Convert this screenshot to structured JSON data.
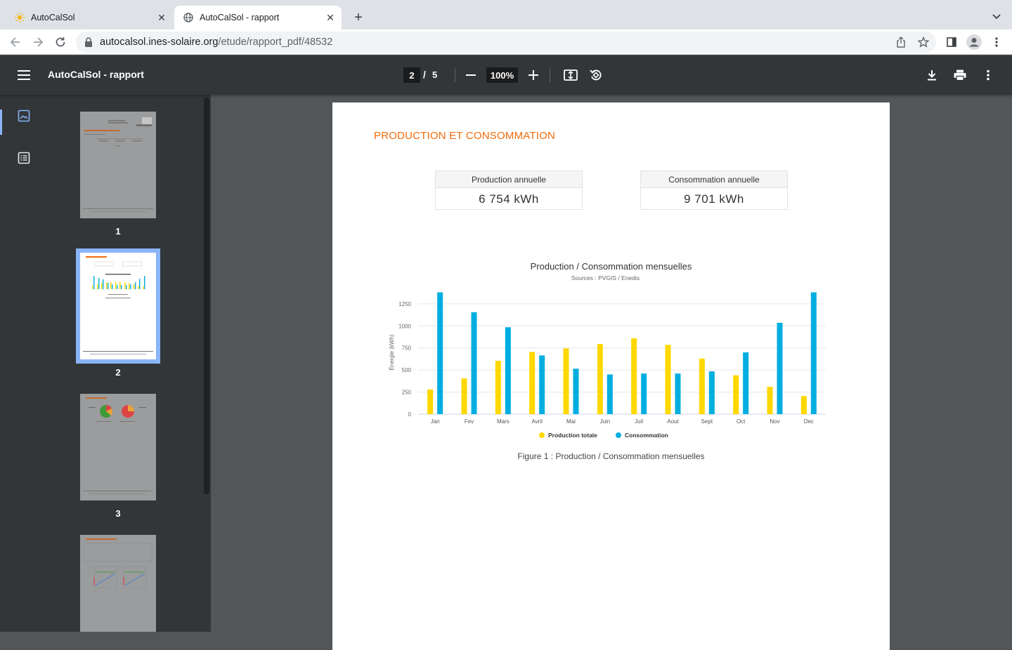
{
  "browser": {
    "tabs": [
      {
        "title": "AutoCalSol",
        "favicon": "sun-icon",
        "active": false
      },
      {
        "title": "AutoCalSol - rapport",
        "favicon": "globe-icon",
        "active": true
      }
    ],
    "url_host": "autocalsol.ines-solaire.org",
    "url_path": "/etude/rapport_pdf/48532"
  },
  "viewer": {
    "title": "AutoCalSol - rapport",
    "current_page": "2",
    "page_separator": "/",
    "total_pages": "5",
    "zoom": "100%",
    "thumbnails": [
      "1",
      "2",
      "3"
    ]
  },
  "report": {
    "section_title": "PRODUCTION ET CONSOMMATION",
    "kpis": [
      {
        "label": "Production annuelle",
        "value": "6 754 kWh"
      },
      {
        "label": "Consommation annuelle",
        "value": "9 701 kWh"
      }
    ],
    "figure_caption": "Figure 1 : Production / Consommation mensuelles"
  },
  "colors": {
    "accent_orange": "#f06b0a",
    "production": "#ffd800",
    "consumption": "#00aee0"
  },
  "chart_data": {
    "type": "bar",
    "title": "Production / Consommation mensuelles",
    "subtitle": "Sources : PVGIS / Enedis",
    "xlabel": "",
    "ylabel": "Énergie (kWh)",
    "ylim": [
      0,
      1400
    ],
    "yticks": [
      0,
      250,
      500,
      750,
      1000,
      1250
    ],
    "categories": [
      "Jan",
      "Fev",
      "Mars",
      "Avril",
      "Mai",
      "Juin",
      "Juil",
      "Aout",
      "Sept",
      "Oct",
      "Nov",
      "Dec"
    ],
    "series": [
      {
        "name": "Production totale",
        "color": "#ffd800",
        "values": [
          280,
          405,
          605,
          705,
          745,
          795,
          860,
          785,
          630,
          440,
          310,
          205
        ]
      },
      {
        "name": "Consommation",
        "color": "#00aee0",
        "values": [
          1380,
          1155,
          985,
          665,
          515,
          450,
          460,
          460,
          485,
          700,
          1035,
          1380
        ]
      }
    ],
    "legend": "bottom-center",
    "grid": true
  }
}
